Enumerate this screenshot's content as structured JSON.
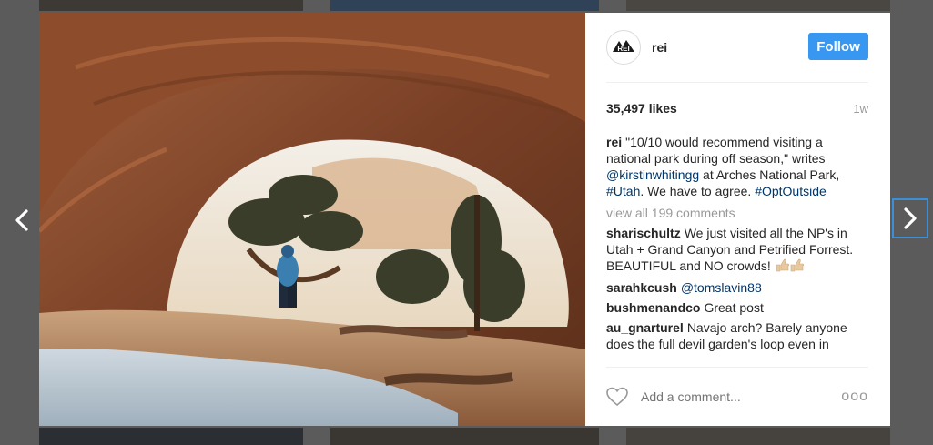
{
  "post": {
    "username": "rei",
    "follow_label": "Follow",
    "likes": "35,497 likes",
    "time": "1w",
    "caption": {
      "username": "rei",
      "text_1": "\"10/10 would recommend visiting a national park during off season,\" writes ",
      "mention": "@kirstinwhitingg",
      "text_2": " at Arches National Park, ",
      "hashtag_1": "#Utah",
      "text_3": ". We have to agree. ",
      "hashtag_2": "#OptOutside"
    },
    "view_all": "view all 199 comments",
    "comments": [
      {
        "username": "sharischultz",
        "text": "We just visited all the NP's in Utah + Grand Canyon and Petrified Forrest. BEAUTIFUL and NO crowds!"
      },
      {
        "username": "sarahkcush",
        "text": "@tomslavin88"
      },
      {
        "username": "bushmenandco",
        "text": "Great post"
      },
      {
        "username": "au_gnarturel",
        "text": "Navajo arch? Barely anyone does the full devil garden's loop even in"
      }
    ],
    "add_comment_placeholder": "Add a comment...",
    "more_options": "ooo",
    "avatar_logo": "REI"
  },
  "icons": {
    "prev": "chevron-left-icon",
    "next": "chevron-right-icon",
    "like": "heart-icon",
    "more": "more-options-icon"
  },
  "colors": {
    "accent": "#3897f0",
    "link": "#003569",
    "muted": "#999999"
  }
}
